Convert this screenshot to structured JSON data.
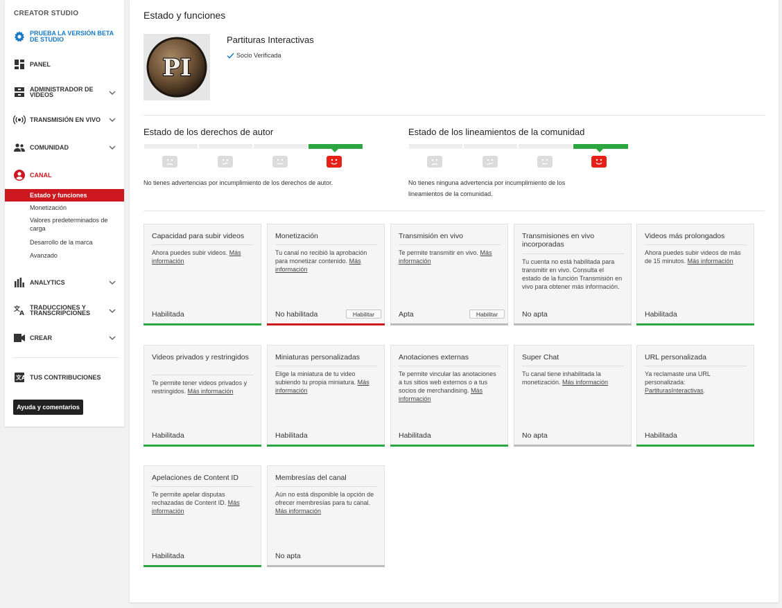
{
  "sidebar": {
    "title": "CREATOR STUDIO",
    "beta_label_1": "PRUEBA LA VERSIÓN BETA",
    "beta_label_2": "DE STUDIO",
    "panel": "PANEL",
    "video_admin_1": "ADMINISTRADOR DE",
    "video_admin_2": "VIDEOS",
    "live": "TRANSMISIÓN EN VIVO",
    "community": "COMUNIDAD",
    "channel": "CANAL",
    "channel_sub": [
      "Estado y funciones",
      "Monetización",
      "Valores predeterminados de",
      "carga",
      "Desarrollo de la marca",
      "Avanzado"
    ],
    "analytics": "ANALYTICS",
    "translations_1": "TRADUCCIONES Y",
    "translations_2": "TRANSCRIPCIONES",
    "create": "CREAR",
    "contributions": "TUS CONTRIBUCIONES",
    "help": "Ayuda y comentarios"
  },
  "header": {
    "title": "Estado y funciones",
    "channel_name": "Partituras Interactivas",
    "verified": "Socio Verificada",
    "avatar_text": "PI"
  },
  "copyright": {
    "title": "Estado de los derechos de autor",
    "text": "No tienes advertencias por incumplimiento de los derechos de autor."
  },
  "community": {
    "title": "Estado de los lineamientos de la comunidad",
    "text_1": "No tienes ninguna advertencia por incumplimiento de los",
    "text_2": "lineamientos de la comunidad."
  },
  "colors": {
    "green": "#2ba640",
    "red": "#cc181e",
    "face_red": "#e62117",
    "blue": "#167ac6"
  },
  "cards": [
    {
      "title": "Capacidad para subir videos",
      "desc": "Ahora puedes subir videos. ",
      "link": "Más información",
      "status": "Habilitada",
      "bar": "green"
    },
    {
      "title": "Monetización",
      "desc": "Tu canal no recibió la aprobación para monetizar contenido. ",
      "link": "Más información",
      "status": "No habilitada",
      "bar": "red",
      "button": "Habilitar"
    },
    {
      "title": "Transmisión en vivo",
      "desc": "Te permite transmitir en vivo. ",
      "link": "Más información",
      "status": "Apta",
      "bar": "gray",
      "button": "Habilitar"
    },
    {
      "title": "Transmisiones en vivo incorporadas",
      "desc": "Tu cuenta no está habilitada para transmitir en vivo. Consulta el estado de la función Transmisión en vivo para obtener más información.",
      "link": "",
      "status": "No apta",
      "bar": "gray"
    },
    {
      "title": "Videos más prolongados",
      "desc": "Ahora puedes subir videos de más de 15 minutos. ",
      "link": "Más información",
      "status": "Habilitada",
      "bar": "green"
    },
    {
      "title": "Videos privados y restringidos",
      "desc": "Te permite tener videos privados y restringidos. ",
      "link": "Más información",
      "status": "Habilitada",
      "bar": "green"
    },
    {
      "title": "Miniaturas personalizadas",
      "desc": "Elige la miniatura de tu video subiendo tu propia miniatura. ",
      "link": "Más información",
      "status": "Habilitada",
      "bar": "green"
    },
    {
      "title": "Anotaciones externas",
      "desc": "Te permite vincular las anotaciones a tus sitios web externos o a tus socios de merchandising. ",
      "link": "Más información",
      "status": "Habilitada",
      "bar": "green"
    },
    {
      "title": "Super Chat",
      "desc": "Tu canal tiene inhabilitada la monetización. ",
      "link": "Más información",
      "status": "No apta",
      "bar": "gray"
    },
    {
      "title": "URL personalizada",
      "desc": "Ya reclamaste una URL personalizada: ",
      "link": "PartiturasInteractivas",
      "tail": ".",
      "status": "Habilitada",
      "bar": "green"
    },
    {
      "title": "Apelaciones de Content ID",
      "desc": "Te permite apelar disputas rechazadas de Content ID. ",
      "link": "Más información",
      "status": "Habilitada",
      "bar": "green"
    },
    {
      "title": "Membresías del canal",
      "desc": "Aún no está disponible la opción de ofrecer membresías para tu canal. ",
      "link": "Más información",
      "status": "No apta",
      "bar": "gray"
    }
  ]
}
